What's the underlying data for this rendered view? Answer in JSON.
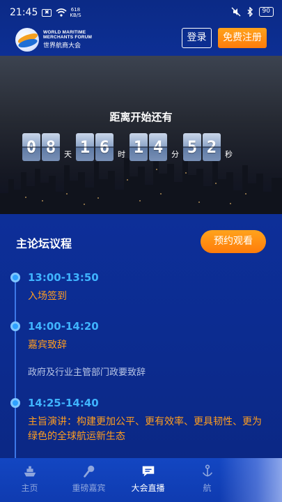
{
  "status_bar": {
    "time": "21:45",
    "notif_badge": "✖",
    "net_speed_value": "618",
    "net_speed_unit": "KB/S",
    "battery": "90"
  },
  "brand": {
    "name_en": "WORLD MARITIME MERCHANTS FORUM",
    "name_cn": "世界航商大会"
  },
  "header": {
    "login_label": "登录",
    "register_label": "免费注册"
  },
  "banner": {
    "countdown_title": "距离开始还有",
    "days": "08",
    "days_unit": "天",
    "hours": "16",
    "hours_unit": "时",
    "minutes": "14",
    "minutes_unit": "分",
    "seconds": "52",
    "seconds_unit": "秒"
  },
  "agenda": {
    "title": "主论坛议程",
    "reserve_label": "预约观看",
    "items": [
      {
        "time": "13:00-13:50",
        "title": "入场签到",
        "desc": ""
      },
      {
        "time": "14:00-14:20",
        "title": "嘉宾致辞",
        "desc": "政府及行业主管部门政要致辞"
      },
      {
        "time": "14:25-14:40",
        "title": "主旨演讲：构建更加公平、更有效率、更具韧性、更为绿色的全球航运新生态",
        "desc": ""
      }
    ]
  },
  "tabbar": {
    "tabs": [
      {
        "label": "主页",
        "icon": "ship-icon"
      },
      {
        "label": "重磅嘉宾",
        "icon": "microphone-icon"
      },
      {
        "label": "大会直播",
        "icon": "live-chat-icon",
        "active": true
      },
      {
        "label": "航",
        "icon": "anchor-icon"
      }
    ]
  },
  "colors": {
    "primary_blue": "#0c2b8e",
    "accent_orange": "#ff8c12",
    "timeline_blue": "#3fb4ff"
  }
}
